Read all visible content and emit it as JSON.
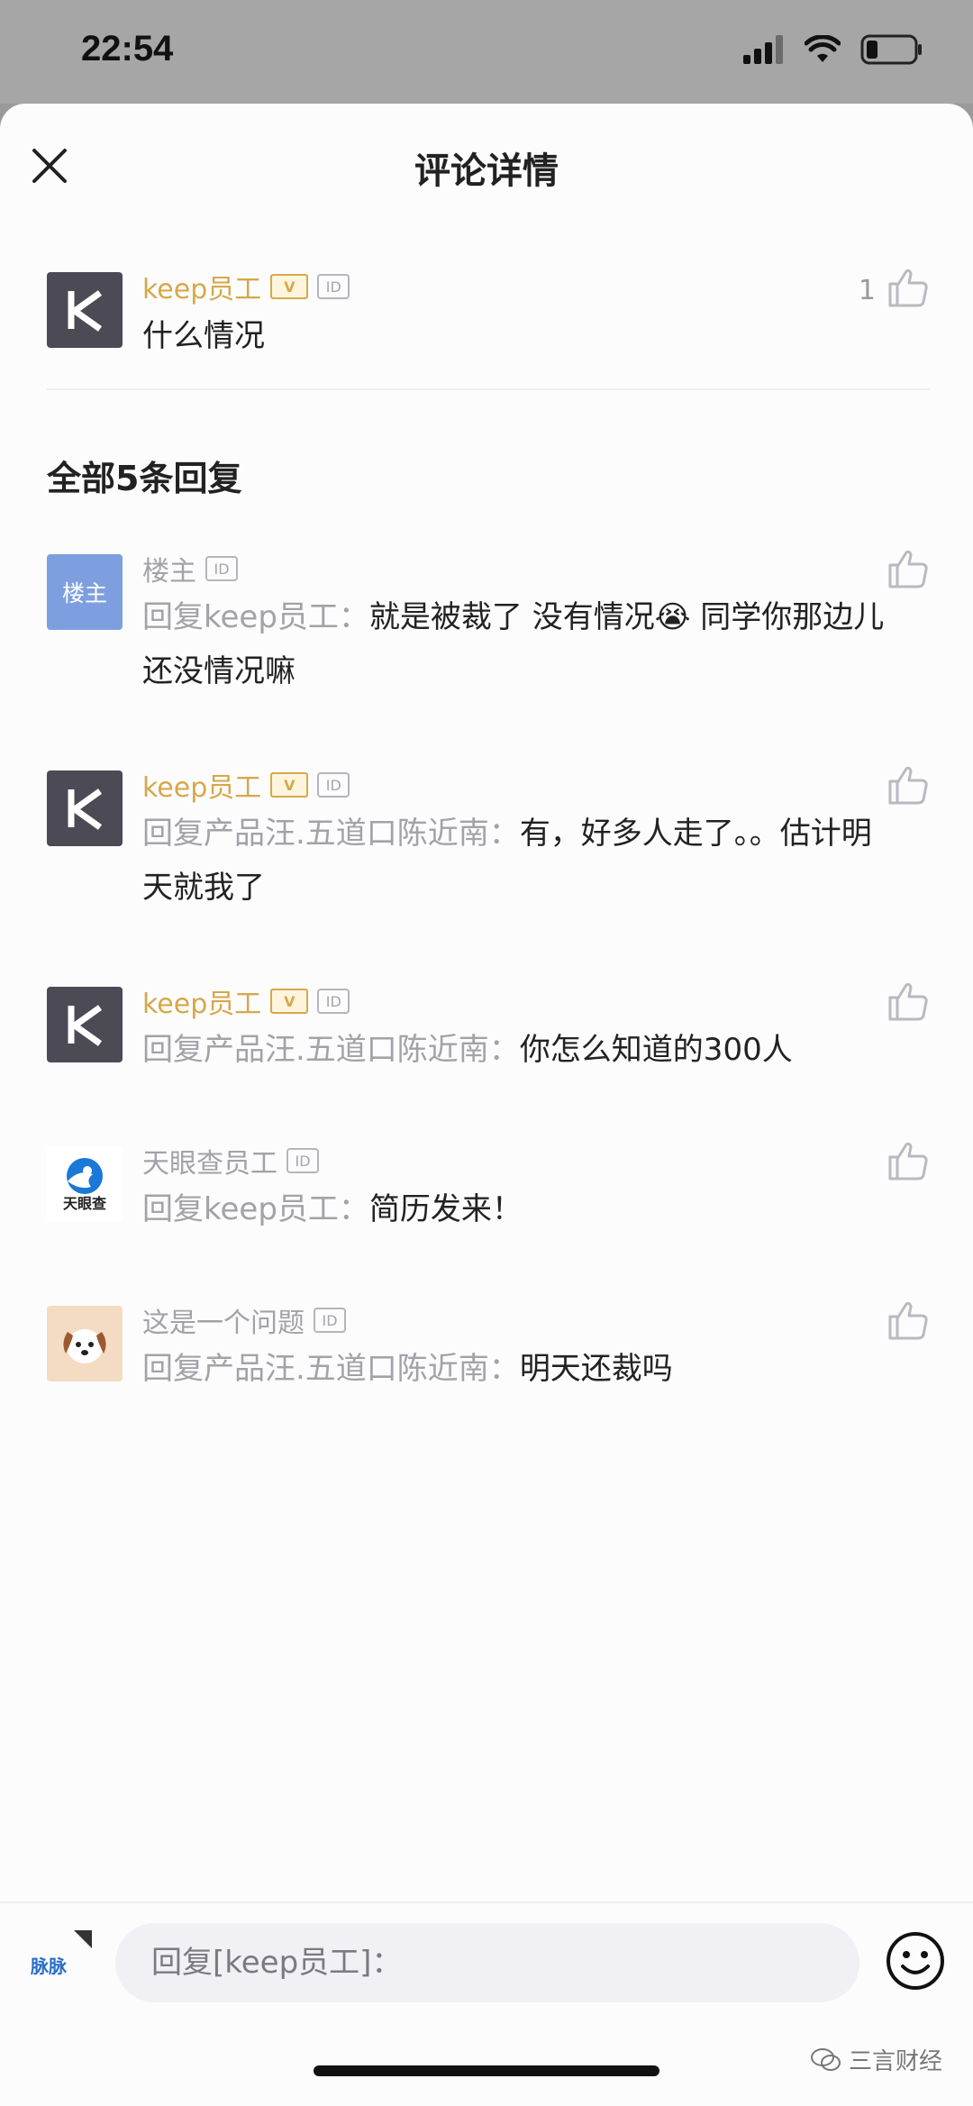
{
  "status": {
    "time": "22:54"
  },
  "header": {
    "title": "评论详情"
  },
  "main_comment": {
    "author": "keep员工",
    "badge_v": "V",
    "badge_id": "ID",
    "avatar_text": "K",
    "text": "什么情况",
    "likes": "1"
  },
  "replies_title": "全部5条回复",
  "replies": [
    {
      "author": "楼主",
      "avatar_text": "楼主",
      "badge_id": "ID",
      "prefix": "回复keep员工：",
      "text": "就是被裁了 没有情况😭 同学你那边儿还没情况嘛"
    },
    {
      "author": "keep员工",
      "avatar_text": "K",
      "badge_v": "V",
      "badge_id": "ID",
      "prefix": "回复产品汪.五道口陈近南：",
      "text": "有，好多人走了。。估计明天就我了"
    },
    {
      "author": "keep员工",
      "avatar_text": "K",
      "badge_v": "V",
      "badge_id": "ID",
      "prefix": "回复产品汪.五道口陈近南：",
      "text": "你怎么知道的300人"
    },
    {
      "author": "天眼查员工",
      "avatar_text": "天眼查",
      "badge_id": "ID",
      "prefix": "回复keep员工：",
      "text": "简历发来！"
    },
    {
      "author": "这是一个问题",
      "badge_id": "ID",
      "prefix": "回复产品汪.五道口陈近南：",
      "text": "明天还裁吗"
    }
  ],
  "composer": {
    "placeholder": "回复[keep员工]：",
    "brand_text": "脉脉"
  },
  "watermark": "三言财经",
  "colors": {
    "gold": "#d6a84a",
    "gray_text": "#a2a2a8",
    "k_avatar": "#4b4a55",
    "owner_avatar": "#7e9fdf"
  }
}
